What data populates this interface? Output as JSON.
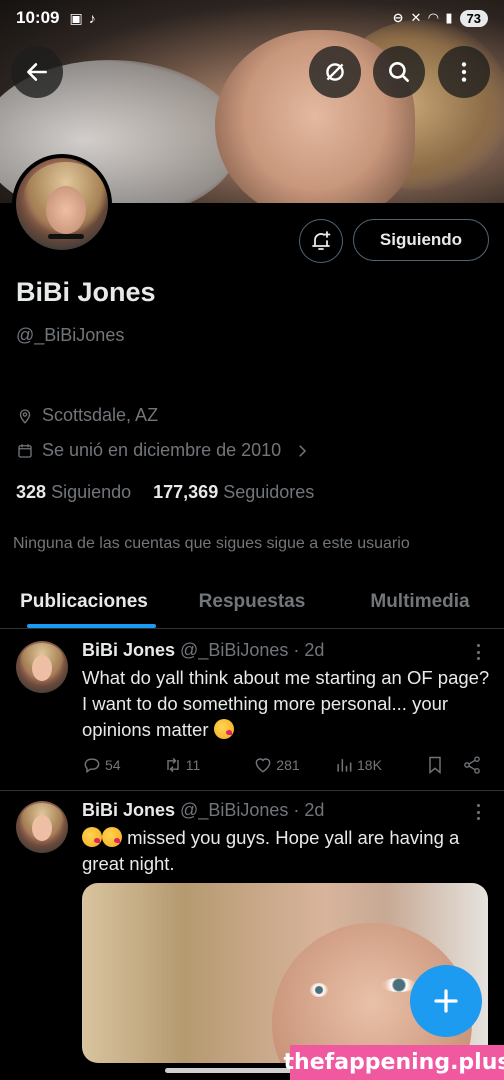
{
  "status_bar": {
    "time": "10:09",
    "battery": "73"
  },
  "profile": {
    "display_name": "BiBi Jones",
    "handle": "@_BiBiJones",
    "location": "Scottsdale, AZ",
    "joined": "Se unió en diciembre de 2010",
    "following_count": "328",
    "following_label": "Siguiendo",
    "followers_count": "177,369",
    "followers_label": "Seguidores",
    "mutuals_note": "Ninguna de las cuentas que sigues sigue a este usuario",
    "follow_button": "Siguiendo"
  },
  "tabs": [
    {
      "label": "Publicaciones",
      "active": true
    },
    {
      "label": "Respuestas",
      "active": false
    },
    {
      "label": "Multimedia",
      "active": false
    }
  ],
  "tweets": [
    {
      "name": "BiBi Jones",
      "handle_time": "@_BiBiJones · 2d",
      "text": "What do yall think about me starting an OF page? I want to do something more personal... your opinions matter",
      "replies": "54",
      "retweets": "11",
      "likes": "281",
      "views": "18K"
    },
    {
      "name": "BiBi Jones",
      "handle_time": "@_BiBiJones · 2d",
      "text": "missed you guys. Hope yall are having a great night."
    }
  ],
  "watermark": "thefappening.plus",
  "colors": {
    "accent": "#1d9bf0",
    "background": "#000000",
    "muted": "#71767b",
    "watermark": "#f058a0"
  },
  "icons": [
    "back-arrow-icon",
    "mute-icon",
    "search-icon",
    "more-vertical-icon",
    "bell-plus-icon",
    "location-pin-icon",
    "calendar-icon",
    "chevron-right-icon",
    "reply-icon",
    "retweet-icon",
    "like-icon",
    "views-icon",
    "bookmark-icon",
    "share-icon",
    "compose-plus-icon"
  ]
}
